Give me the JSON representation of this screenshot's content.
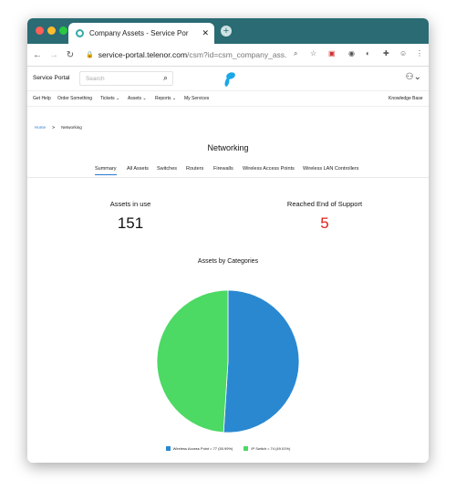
{
  "browser": {
    "tab_title": "Company Assets - Service Por",
    "url_host": "service-portal.telenor.com",
    "url_path": "/csm?id=csm_company_ass..."
  },
  "site": {
    "brand": "Service Portal",
    "search_placeholder": "Search"
  },
  "menu": {
    "items": [
      "Get Help",
      "Order Something",
      "Tickets ⌄",
      "Assets ⌄",
      "Reports ⌄",
      "My Services"
    ],
    "right": "Knowledge Base"
  },
  "breadcrumb": {
    "home": "Home",
    "separator": ">",
    "current": "Networking"
  },
  "page_title": "Networking",
  "tabs": [
    "Summary",
    "All Assets",
    "Switches",
    "Routers",
    "Firewalls",
    "Wireless Access Points",
    "Wireless LAN Controllers"
  ],
  "stats": {
    "in_use_label": "Assets in use",
    "in_use_value": "151",
    "eos_label": "Reached End of Support",
    "eos_value": "5"
  },
  "chart_title": "Assets by Categories",
  "chart_data": {
    "type": "pie",
    "categories": [
      "Wireless Access Point = 77 (50.99%)",
      "IP Switch = 74 (49.01%)"
    ],
    "values": [
      77,
      74
    ],
    "colors": [
      "#2a88d1",
      "#4cd964"
    ]
  },
  "colors": {
    "titlebar": "#2a6b74",
    "link": "#2a7bd1",
    "alert": "#e02020"
  }
}
